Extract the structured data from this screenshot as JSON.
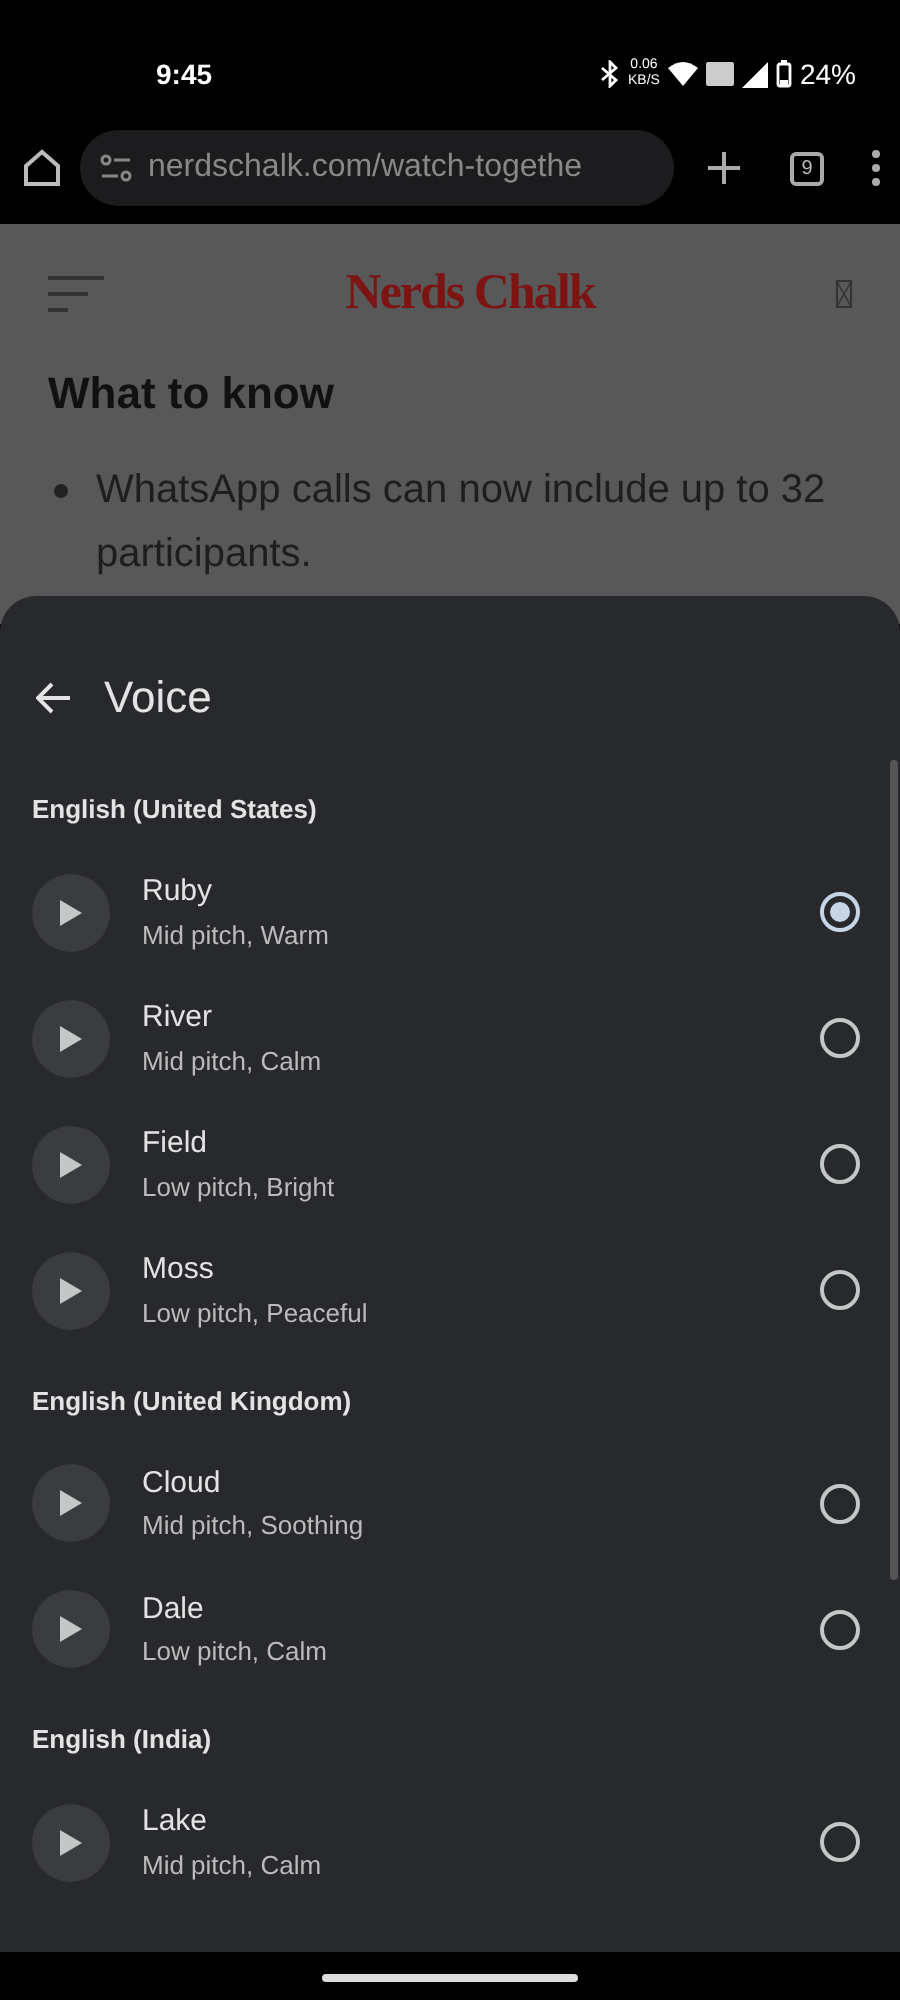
{
  "status_bar": {
    "time": "9:45",
    "speed_value": "0.06",
    "speed_unit": "KB/S",
    "battery": "24%"
  },
  "browser": {
    "url": "nerdschalk.com/watch-togethe",
    "tab_count": "9"
  },
  "page": {
    "logo": "Nerds Chalk",
    "heading": "What to know",
    "bullet": "WhatsApp calls can now include up to 32 participants."
  },
  "sheet": {
    "title": "Voice",
    "groups": [
      {
        "label": "English (United States)",
        "voices": [
          {
            "name": "Ruby",
            "description": "Mid pitch, Warm",
            "selected": true
          },
          {
            "name": "River",
            "description": "Mid pitch, Calm",
            "selected": false
          },
          {
            "name": "Field",
            "description": "Low pitch, Bright",
            "selected": false
          },
          {
            "name": "Moss",
            "description": "Low pitch, Peaceful",
            "selected": false
          }
        ]
      },
      {
        "label": "English (United Kingdom)",
        "voices": [
          {
            "name": "Cloud",
            "description": "Mid pitch, Soothing",
            "selected": false
          },
          {
            "name": "Dale",
            "description": "Low pitch, Calm",
            "selected": false
          }
        ]
      },
      {
        "label": "English (India)",
        "voices": [
          {
            "name": "Lake",
            "description": "Mid pitch, Calm",
            "selected": false
          }
        ]
      }
    ]
  }
}
